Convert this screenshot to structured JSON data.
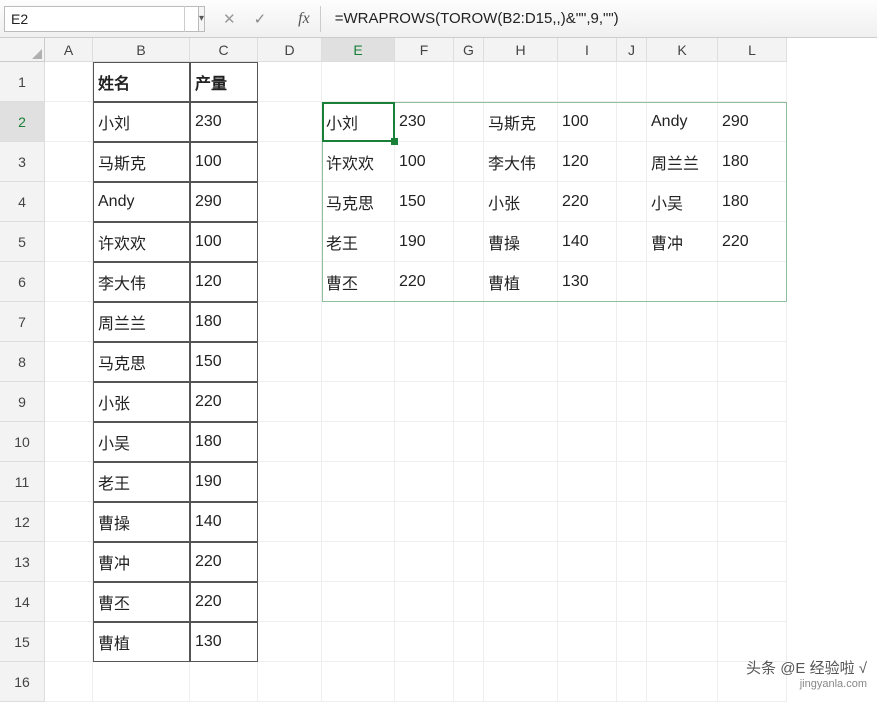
{
  "namebox": "E2",
  "formula": "=WRAPROWS(TOROW(B2:D15,,)&\"\",9,\"\")",
  "column_headers": [
    "A",
    "B",
    "C",
    "D",
    "E",
    "F",
    "G",
    "H",
    "I",
    "J",
    "K",
    "L"
  ],
  "row_headers": [
    "1",
    "2",
    "3",
    "4",
    "5",
    "6",
    "7",
    "8",
    "9",
    "10",
    "11",
    "12",
    "13",
    "14",
    "15",
    "16"
  ],
  "source_table": {
    "headers": {
      "name": "姓名",
      "qty": "产量"
    },
    "rows": [
      {
        "name": "小刘",
        "qty": "230"
      },
      {
        "name": "马斯克",
        "qty": "100"
      },
      {
        "name": "Andy",
        "qty": "290"
      },
      {
        "name": "许欢欢",
        "qty": "100"
      },
      {
        "name": "李大伟",
        "qty": "120"
      },
      {
        "name": "周兰兰",
        "qty": "180"
      },
      {
        "name": "马克思",
        "qty": "150"
      },
      {
        "name": "小张",
        "qty": "220"
      },
      {
        "name": "小吴",
        "qty": "180"
      },
      {
        "name": "老王",
        "qty": "190"
      },
      {
        "name": "曹操",
        "qty": "140"
      },
      {
        "name": "曹冲",
        "qty": "220"
      },
      {
        "name": "曹丕",
        "qty": "220"
      },
      {
        "name": "曹植",
        "qty": "130"
      }
    ]
  },
  "spill": [
    [
      "小刘",
      "230",
      "",
      "马斯克",
      "100",
      "",
      "Andy",
      "290"
    ],
    [
      "许欢欢",
      "100",
      "",
      "李大伟",
      "120",
      "",
      "周兰兰",
      "180"
    ],
    [
      "马克思",
      "150",
      "",
      "小张",
      "220",
      "",
      "小吴",
      "180"
    ],
    [
      "老王",
      "190",
      "",
      "曹操",
      "140",
      "",
      "曹冲",
      "220"
    ],
    [
      "曹丕",
      "220",
      "",
      "曹植",
      "130",
      "",
      "",
      ""
    ]
  ],
  "icons": {
    "dropdown": "▾",
    "cancel": "✕",
    "confirm": "✓",
    "fx": "fx"
  },
  "watermark": {
    "line1": "头条 @E 经验啦 √",
    "line2": "jingyanla.com"
  }
}
